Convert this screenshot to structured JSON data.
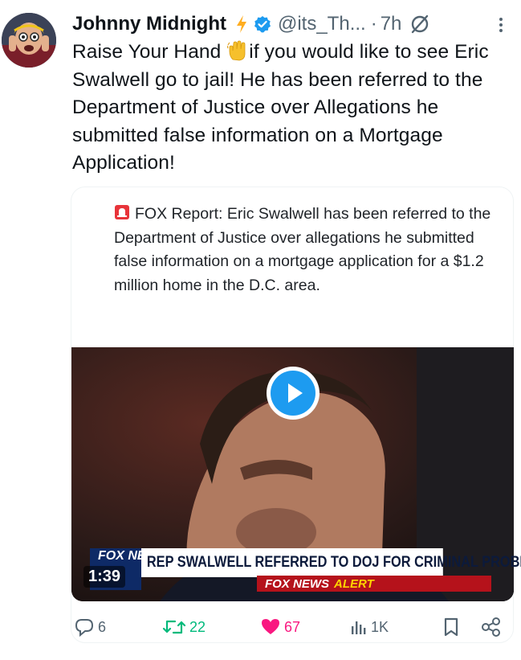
{
  "tweet": {
    "author_name": "Johnny Midnight",
    "handle": "@its_Th...",
    "separator": "·",
    "time": "7h",
    "text_before": "Raise Your Hand ",
    "text_after": "if you would like to see Eric Swalwell go to jail! He has been referred to the Department of Justice over Allegations he submitted false information on a Mortgage Application!"
  },
  "quote": {
    "text": "FOX Report: Eric Swalwell has been referred to the Department of Justice over allegations he submitted false information on a mortgage application for a $1.2 million home in the D.C. area."
  },
  "video": {
    "duration": "1:39",
    "chyron": "REP SWALWELL REFERRED TO DOJ FOR CRIMINAL PROBE",
    "alert_prefix": "FOX NEWS",
    "alert_word": "ALERT",
    "network_logo": "FOX NEWS"
  },
  "actions": {
    "replies": "6",
    "reposts": "22",
    "likes": "67",
    "views": "1K"
  },
  "colors": {
    "accent": "#1d9bf0",
    "repost": "#00ba7c",
    "like": "#f91880",
    "muted": "#536471",
    "bolt": "#ffad1f"
  }
}
